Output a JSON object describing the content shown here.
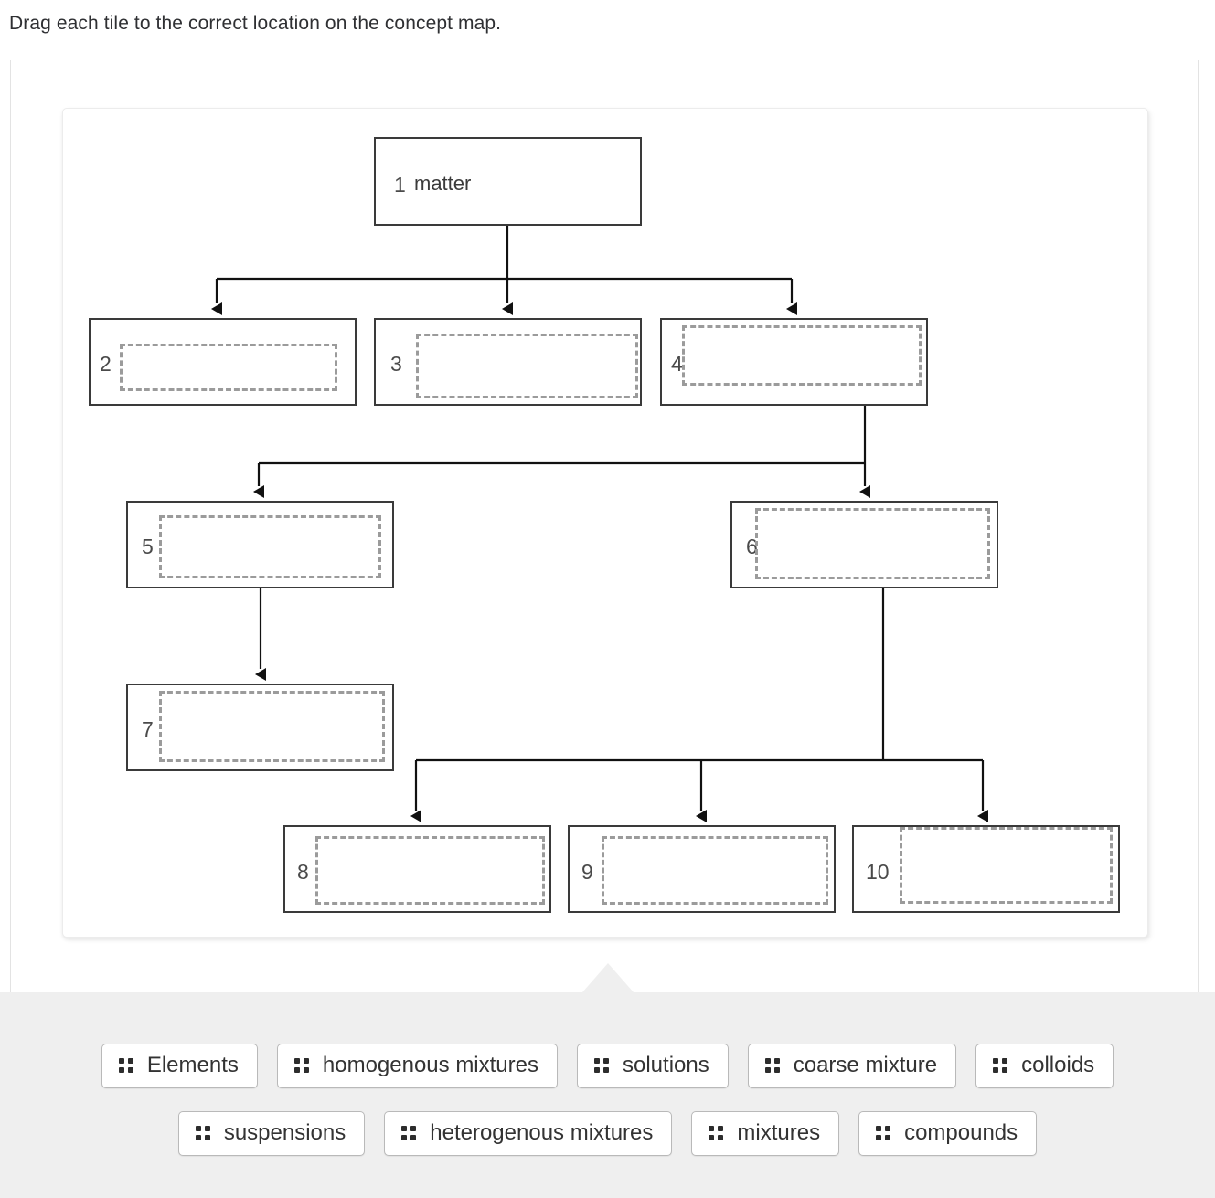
{
  "prompt": "Drag each tile to the correct location on the concept map.",
  "concept_map": {
    "nodes": [
      {
        "number": "1",
        "filled_text": "matter",
        "empty": false
      },
      {
        "number": "2",
        "filled_text": "",
        "empty": true
      },
      {
        "number": "3",
        "filled_text": "",
        "empty": true
      },
      {
        "number": "4",
        "filled_text": "",
        "empty": true
      },
      {
        "number": "5",
        "filled_text": "",
        "empty": true
      },
      {
        "number": "6",
        "filled_text": "",
        "empty": true
      },
      {
        "number": "7",
        "filled_text": "",
        "empty": true
      },
      {
        "number": "8",
        "filled_text": "",
        "empty": true
      },
      {
        "number": "9",
        "filled_text": "",
        "empty": true
      },
      {
        "number": "10",
        "filled_text": "",
        "empty": true
      }
    ],
    "connections": [
      {
        "from": "1",
        "to": [
          "2",
          "3",
          "4"
        ]
      },
      {
        "from": "4",
        "to": [
          "5",
          "6"
        ]
      },
      {
        "from": "5",
        "to": [
          "7"
        ]
      },
      {
        "from": "6",
        "to": [
          "8",
          "9",
          "10"
        ]
      }
    ]
  },
  "tiles": {
    "grip_icon": "drag-handle-icon",
    "row1": [
      {
        "label": "Elements"
      },
      {
        "label": "homogenous mixtures"
      },
      {
        "label": "solutions"
      },
      {
        "label": "coarse mixture"
      },
      {
        "label": "colloids"
      }
    ],
    "row2": [
      {
        "label": "suspensions"
      },
      {
        "label": "heterogenous mixtures"
      },
      {
        "label": "mixtures"
      },
      {
        "label": "compounds"
      }
    ]
  },
  "colors": {
    "node_border": "#3a3a3a",
    "dropzone_border": "#9b9b9b",
    "tray_bg": "#efefef",
    "text": "#333333"
  }
}
